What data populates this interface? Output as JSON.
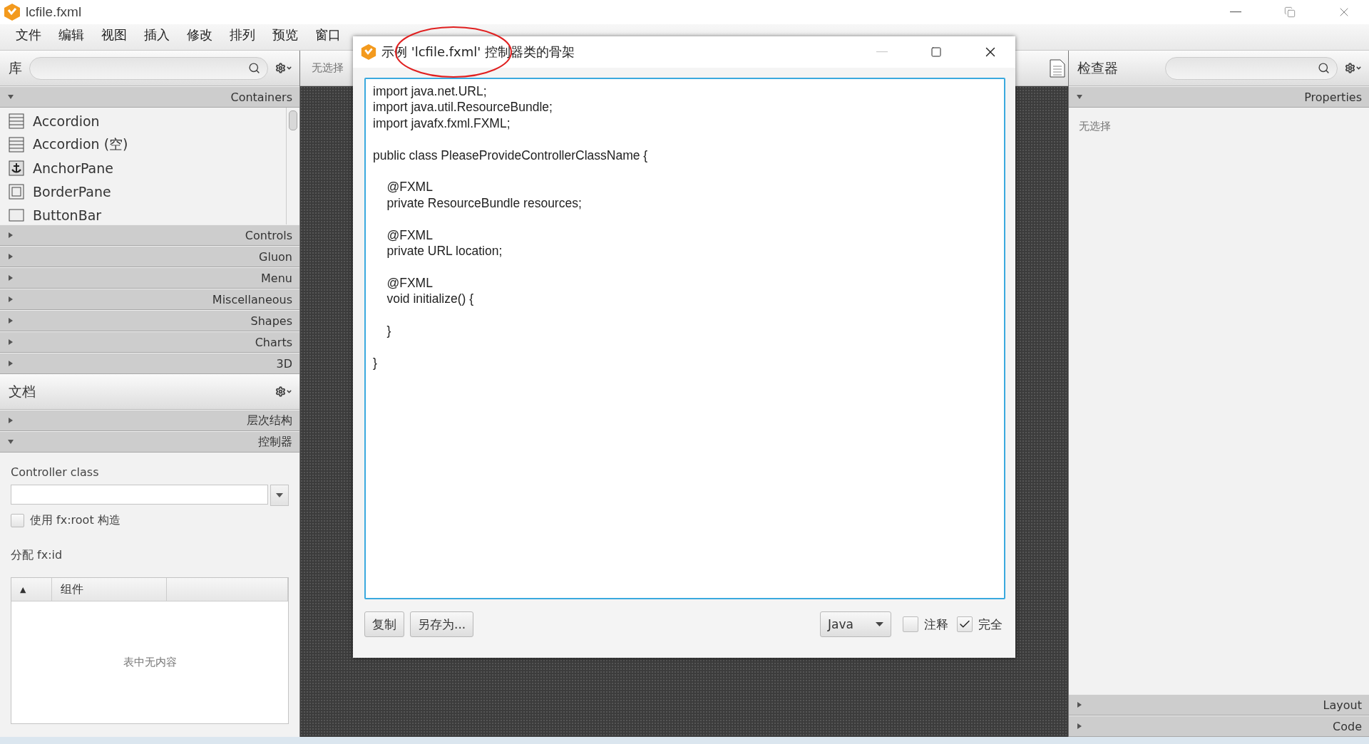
{
  "window": {
    "title": "lcfile.fxml"
  },
  "menu": [
    "文件",
    "编辑",
    "视图",
    "插入",
    "修改",
    "排列",
    "预览",
    "窗口"
  ],
  "library": {
    "title": "库",
    "sections": [
      {
        "label": "Containers",
        "expanded": true,
        "items": [
          {
            "label": "Accordion",
            "kind": "accordion"
          },
          {
            "label": "Accordion  (空)",
            "kind": "accordion"
          },
          {
            "label": "AnchorPane",
            "kind": "anchor"
          },
          {
            "label": "BorderPane",
            "kind": "border"
          },
          {
            "label": "ButtonBar",
            "kind": "bar"
          }
        ]
      },
      {
        "label": "Controls",
        "expanded": false
      },
      {
        "label": "Gluon",
        "expanded": false
      },
      {
        "label": "Menu",
        "expanded": false
      },
      {
        "label": "Miscellaneous",
        "expanded": false
      },
      {
        "label": "Shapes",
        "expanded": false
      },
      {
        "label": "Charts",
        "expanded": false
      },
      {
        "label": "3D",
        "expanded": false
      }
    ]
  },
  "document": {
    "title": "文档",
    "sections": [
      {
        "label": "层次结构",
        "expanded": false
      },
      {
        "label": "控制器",
        "expanded": true
      }
    ],
    "controller_class_label": "Controller class",
    "fx_root": {
      "label": "使用 fx:root 构造",
      "checked": false
    },
    "assign_label": "分配 fx:id",
    "table": {
      "sort_mark": "▲",
      "columns": [
        "组件"
      ],
      "empty_text": "表中无内容"
    }
  },
  "canvas": {
    "selection": "无选择"
  },
  "inspector": {
    "title": "检查器",
    "sections": [
      {
        "label": "Properties",
        "expanded": true
      },
      {
        "label": "Layout",
        "expanded": false
      },
      {
        "label": "Code",
        "expanded": false
      }
    ],
    "empty_text": "无选择"
  },
  "dialog": {
    "title": "示例 'lcfile.fxml' 控制器类的骨架",
    "code": "import java.net.URL;\nimport java.util.ResourceBundle;\nimport javafx.fxml.FXML;\n\npublic class PleaseProvideControllerClassName {\n\n    @FXML\n    private ResourceBundle resources;\n\n    @FXML\n    private URL location;\n\n    @FXML\n    void initialize() {\n\n    }\n\n}",
    "buttons": [
      "复制",
      "另存为..."
    ],
    "language": "Java",
    "options": [
      {
        "label": "注释",
        "checked": false
      },
      {
        "label": "完全",
        "checked": true
      }
    ]
  },
  "annotation": {
    "kind": "ellipse",
    "color": "#e02020"
  }
}
